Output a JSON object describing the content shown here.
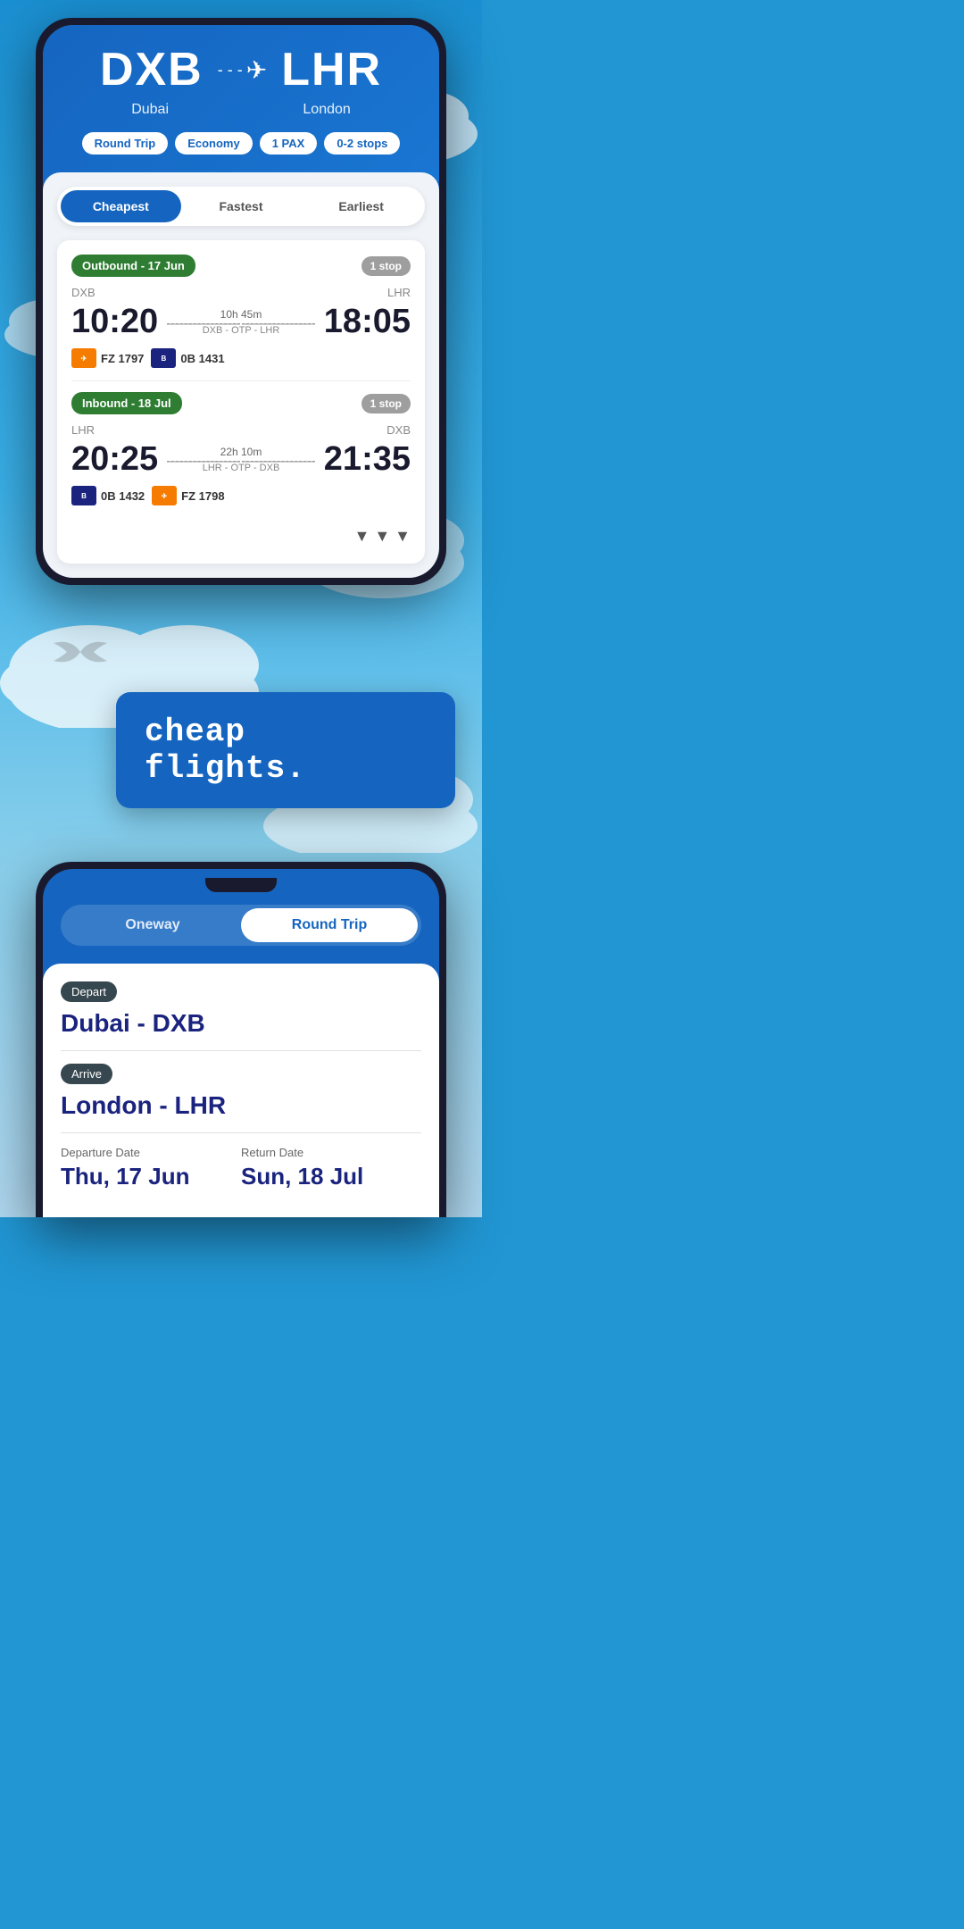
{
  "app": {
    "tagline": "cheap flights."
  },
  "phone1": {
    "route": {
      "origin_code": "DXB",
      "origin_city": "Dubai",
      "destination_code": "LHR",
      "destination_city": "London",
      "trip_type": "Round Trip",
      "cabin": "Economy",
      "pax": "1 PAX",
      "stops": "0-2 stops"
    },
    "tabs": {
      "cheapest": "Cheapest",
      "fastest": "Fastest",
      "earliest": "Earliest"
    },
    "outbound": {
      "label": "Outbound - 17 Jun",
      "stop_badge": "1 stop",
      "origin": "DXB",
      "destination": "LHR",
      "depart_time": "10:20",
      "arrive_time": "18:05",
      "duration": "10h 45m",
      "route_via": "DXB - OTP - LHR",
      "airline1_code": "FZ 1797",
      "airline1_logo": "dubai",
      "airline2_code": "0B 1431",
      "airline2_logo": "bluair"
    },
    "inbound": {
      "label": "Inbound - 18 Jul",
      "stop_badge": "1 stop",
      "origin": "LHR",
      "destination": "DXB",
      "depart_time": "20:25",
      "arrive_time": "21:35",
      "duration": "22h 10m",
      "route_via": "LHR - OTP - DXB",
      "airline1_code": "0B 1432",
      "airline1_logo": "bluair",
      "airline2_code": "FZ 1798",
      "airline2_logo": "dubai"
    }
  },
  "phone2": {
    "toggle": {
      "oneway": "Oneway",
      "round_trip": "Round Trip"
    },
    "depart_label": "Depart",
    "depart_value": "Dubai - DXB",
    "arrive_label": "Arrive",
    "arrive_value": "London - LHR",
    "departure_date_label": "Departure Date",
    "departure_date": "Thu, 17 Jun",
    "return_date_label": "Return Date",
    "return_date": "Sun, 18 Jul"
  }
}
